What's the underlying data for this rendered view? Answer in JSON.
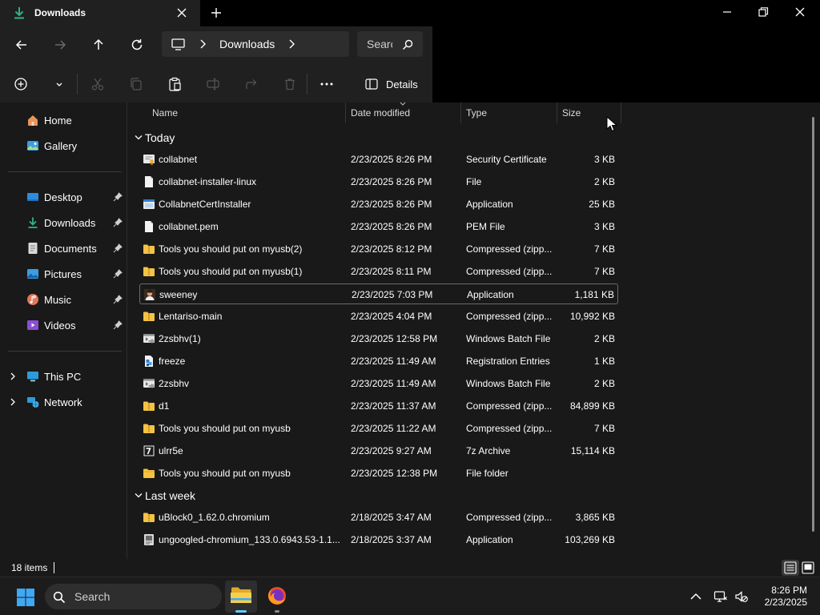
{
  "window": {
    "tab_title": "Downloads",
    "accent": "#60cdff"
  },
  "address": {
    "breadcrumb": "Downloads",
    "search_placeholder": "Search"
  },
  "commandbar": {
    "details_label": "Details"
  },
  "sidebar": {
    "items": [
      {
        "label": "Home",
        "icon": "home-icon"
      },
      {
        "label": "Gallery",
        "icon": "gallery-icon"
      },
      {
        "label": "Desktop",
        "icon": "desktop-icon"
      },
      {
        "label": "Downloads",
        "icon": "download-icon"
      },
      {
        "label": "Documents",
        "icon": "documents-icon"
      },
      {
        "label": "Pictures",
        "icon": "pictures-icon"
      },
      {
        "label": "Music",
        "icon": "music-icon"
      },
      {
        "label": "Videos",
        "icon": "videos-icon"
      },
      {
        "label": "This PC",
        "icon": "this-pc-icon"
      },
      {
        "label": "Network",
        "icon": "network-icon"
      }
    ]
  },
  "columns": {
    "name": "Name",
    "date": "Date modified",
    "type": "Type",
    "size": "Size"
  },
  "groups": {
    "today": "Today",
    "last_week": "Last week"
  },
  "files": [
    {
      "name": "collabnet",
      "date": "2/23/2025 8:26 PM",
      "type": "Security Certificate",
      "size": "3 KB",
      "icon": "certificate-icon"
    },
    {
      "name": "collabnet-installer-linux",
      "date": "2/23/2025 8:26 PM",
      "type": "File",
      "size": "2 KB",
      "icon": "file-icon"
    },
    {
      "name": "CollabnetCertInstaller",
      "date": "2/23/2025 8:26 PM",
      "type": "Application",
      "size": "25 KB",
      "icon": "application-icon"
    },
    {
      "name": "collabnet.pem",
      "date": "2/23/2025 8:26 PM",
      "type": "PEM File",
      "size": "3 KB",
      "icon": "file-icon"
    },
    {
      "name": "Tools you should put on myusb(2)",
      "date": "2/23/2025 8:12 PM",
      "type": "Compressed (zipp...",
      "size": "7 KB",
      "icon": "zip-folder-icon"
    },
    {
      "name": "Tools you should put on myusb(1)",
      "date": "2/23/2025 8:11 PM",
      "type": "Compressed (zipp...",
      "size": "7 KB",
      "icon": "zip-folder-icon"
    },
    {
      "name": "sweeney",
      "date": "2/23/2025 7:03 PM",
      "type": "Application",
      "size": "1,181 KB",
      "icon": "portrait-app-icon"
    },
    {
      "name": "Lentariso-main",
      "date": "2/23/2025 4:04 PM",
      "type": "Compressed (zipp...",
      "size": "10,992 KB",
      "icon": "zip-folder-icon"
    },
    {
      "name": "2zsbhv(1)",
      "date": "2/23/2025 12:58 PM",
      "type": "Windows Batch File",
      "size": "2 KB",
      "icon": "batch-file-icon"
    },
    {
      "name": "freeze",
      "date": "2/23/2025 11:49 AM",
      "type": "Registration Entries",
      "size": "1 KB",
      "icon": "registry-icon"
    },
    {
      "name": "2zsbhv",
      "date": "2/23/2025 11:49 AM",
      "type": "Windows Batch File",
      "size": "2 KB",
      "icon": "batch-file-icon"
    },
    {
      "name": "d1",
      "date": "2/23/2025 11:37 AM",
      "type": "Compressed (zipp...",
      "size": "84,899 KB",
      "icon": "zip-folder-icon"
    },
    {
      "name": "Tools you should put on myusb",
      "date": "2/23/2025 11:22 AM",
      "type": "Compressed (zipp...",
      "size": "7 KB",
      "icon": "zip-folder-icon"
    },
    {
      "name": "ulrr5e",
      "date": "2/23/2025 9:27 AM",
      "type": "7z Archive",
      "size": "15,114 KB",
      "icon": "7z-archive-icon"
    },
    {
      "name": "Tools you should put on myusb",
      "date": "2/23/2025 12:38 PM",
      "type": "File folder",
      "size": "",
      "icon": "folder-icon"
    },
    {
      "name": "uBlock0_1.62.0.chromium",
      "date": "2/18/2025 3:47 AM",
      "type": "Compressed (zipp...",
      "size": "3,865 KB",
      "icon": "zip-folder-icon"
    },
    {
      "name": "ungoogled-chromium_133.0.6943.53-1.1...",
      "date": "2/18/2025 3:37 AM",
      "type": "Application",
      "size": "103,269 KB",
      "icon": "installer-icon"
    }
  ],
  "status": {
    "item_count": "18 items"
  },
  "taskbar": {
    "search_label": "Search",
    "time": "8:26 PM",
    "date": "2/23/2025"
  }
}
